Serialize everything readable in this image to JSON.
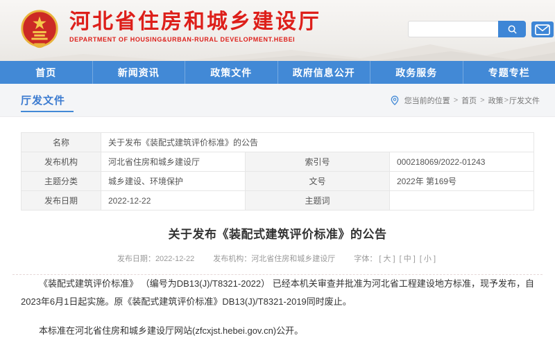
{
  "colors": {
    "nav_blue": "#4289d6",
    "brand_red": "#dd1f1a",
    "link_blue": "#3a7ad0",
    "label_cell_bg": "#f4f4f4"
  },
  "header": {
    "site_title": "河北省住房和城乡建设厅",
    "site_subtitle": "DEPARTMENT OF HOUSING&URBAN-RURAL DEVELOPMENT.HEBEI",
    "search_value": ""
  },
  "nav": {
    "items": [
      {
        "label": "首页"
      },
      {
        "label": "新闻资讯"
      },
      {
        "label": "政策文件"
      },
      {
        "label": "政府信息公开"
      },
      {
        "label": "政务服务"
      },
      {
        "label": "专题专栏"
      }
    ]
  },
  "subheader": {
    "section_title": "厅发文件",
    "breadcrumb": {
      "prefix": "您当前的位置",
      "separator": ">",
      "crumbs": [
        "首页",
        "政策",
        "厅发文件"
      ]
    }
  },
  "info_table": {
    "rows": [
      {
        "label": "名称",
        "value": "关于发布《装配式建筑评价标准》的公告"
      },
      {
        "label": "发布机构",
        "value": "河北省住房和城乡建设厅",
        "label2": "索引号",
        "value2": "000218069/2022-01243"
      },
      {
        "label": "主题分类",
        "value": "城乡建设、环境保护",
        "label2": "文号",
        "value2": "2022年 第169号"
      },
      {
        "label": "发布日期",
        "value": "2022-12-22",
        "label2": "主题词",
        "value2": ""
      }
    ]
  },
  "article": {
    "title": "关于发布《装配式建筑评价标准》的公告",
    "meta": {
      "date_label": "发布日期：",
      "date": "2022-12-22",
      "agency_label": "发布机构：",
      "agency": "河北省住房和城乡建设厅",
      "font_label": "字体：",
      "font_large": "[ 大 ]",
      "font_medium": "[ 中 ]",
      "font_small": "[ 小 ]"
    },
    "paragraphs": [
      "《装配式建筑评价标准》 （编号为DB13(J)/T8321-2022） 已经本机关审查并批准为河北省工程建设地方标准，现予发布，自2023年6月1日起实施。原《装配式建筑评价标准》DB13(J)/T8321-2019同时废止。",
      "本标准在河北省住房和城乡建设厅网站(zfcxjst.hebei.gov.cn)公开。"
    ]
  }
}
